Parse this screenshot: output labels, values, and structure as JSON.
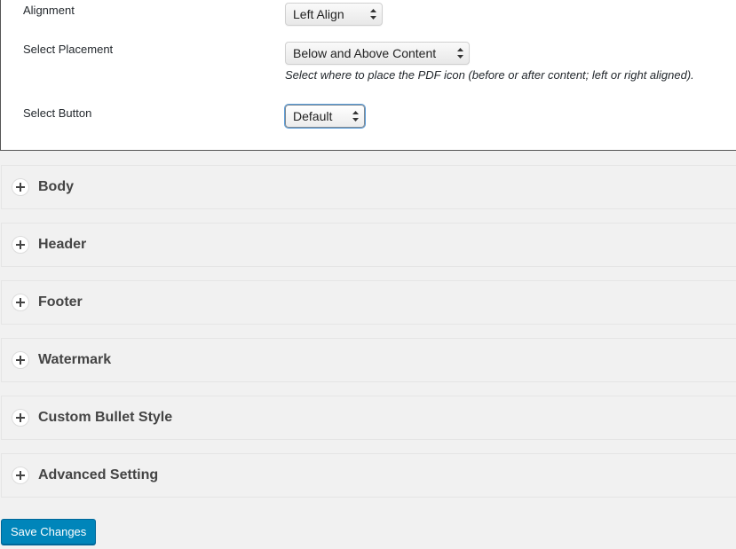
{
  "settings": {
    "alignment": {
      "label": "Alignment",
      "value": "Left Align"
    },
    "placement": {
      "label": "Select Placement",
      "value": "Below and Above Content",
      "help": "Select where to place the PDF icon (before or after content; left or right aligned)."
    },
    "button": {
      "label": "Select Button",
      "value": "Default"
    }
  },
  "sections": [
    {
      "title": "Body"
    },
    {
      "title": "Header"
    },
    {
      "title": "Footer"
    },
    {
      "title": "Watermark"
    },
    {
      "title": "Custom Bullet Style"
    },
    {
      "title": "Advanced Setting"
    }
  ],
  "actions": {
    "save_label": "Save Changes"
  },
  "colors": {
    "primary_button": "#0085ba",
    "focus_ring": "#5b9dd9"
  }
}
